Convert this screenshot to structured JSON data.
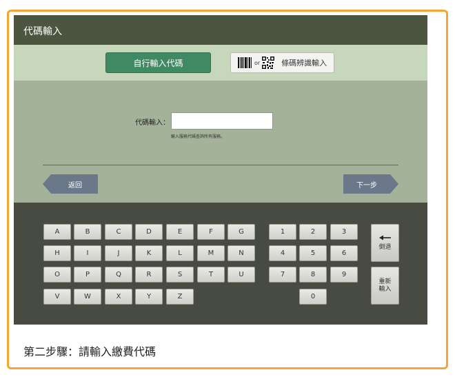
{
  "header": {
    "title": "代碼輸入"
  },
  "modes": {
    "manual_label": "自行輸入代碼",
    "barcode_or": "or",
    "barcode_label": "條碼辨識輸入"
  },
  "form": {
    "code_label": "代碼輸入：",
    "code_value": "",
    "hint": "輸入服務代碼查詢所有服務。"
  },
  "nav": {
    "back_label": "返回",
    "next_label": "下一步"
  },
  "keyboard": {
    "letters": [
      [
        "A",
        "B",
        "C",
        "D",
        "E",
        "F",
        "G"
      ],
      [
        "H",
        "I",
        "J",
        "K",
        "L",
        "M",
        "N"
      ],
      [
        "O",
        "P",
        "Q",
        "R",
        "S",
        "T",
        "U"
      ],
      [
        "V",
        "W",
        "X",
        "Y",
        "Z"
      ]
    ],
    "digits": [
      [
        "1",
        "2",
        "3"
      ],
      [
        "4",
        "5",
        "6"
      ],
      [
        "7",
        "8",
        "9"
      ],
      [
        "",
        "0",
        ""
      ]
    ],
    "backspace_label": "倒退",
    "reset_label_line1": "重新",
    "reset_label_line2": "輸入"
  },
  "caption": "第二步驟：請輸入繳費代碼",
  "colors": {
    "frame_border": "#f4a534",
    "title_bar": "#4b5540",
    "mode_bar": "#c6d7bc",
    "manual_button": "#3f8a63",
    "main_panel": "#a4b29a",
    "nav_button": "#6a788a",
    "keyboard_panel": "#474b41"
  }
}
